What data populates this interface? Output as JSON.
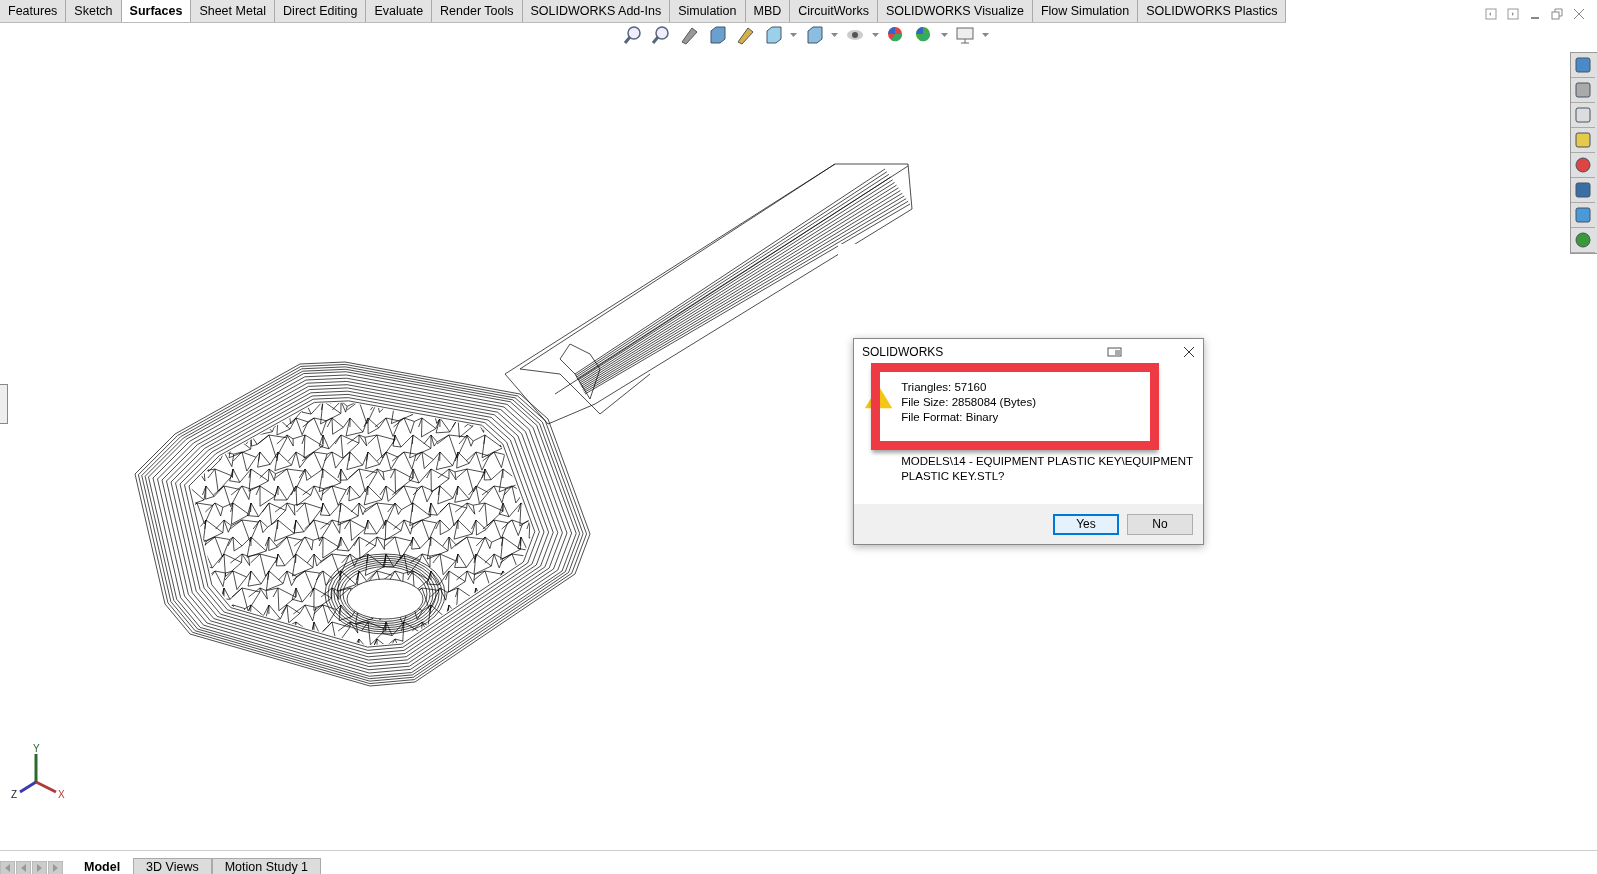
{
  "ribbon_tabs": [
    {
      "label": "Features",
      "selected": false
    },
    {
      "label": "Sketch",
      "selected": false
    },
    {
      "label": "Surfaces",
      "selected": true
    },
    {
      "label": "Sheet Metal",
      "selected": false
    },
    {
      "label": "Direct Editing",
      "selected": false
    },
    {
      "label": "Evaluate",
      "selected": false
    },
    {
      "label": "Render Tools",
      "selected": false
    },
    {
      "label": "SOLIDWORKS Add-Ins",
      "selected": false
    },
    {
      "label": "Simulation",
      "selected": false
    },
    {
      "label": "MBD",
      "selected": false
    },
    {
      "label": "CircuitWorks",
      "selected": false
    },
    {
      "label": "SOLIDWORKS Visualize",
      "selected": false
    },
    {
      "label": "Flow Simulation",
      "selected": false
    },
    {
      "label": "SOLIDWORKS Plastics",
      "selected": false
    }
  ],
  "dialog": {
    "title": "SOLIDWORKS",
    "info_lines": [
      "Triangles: 57160",
      "File Size: 2858084 (Bytes)",
      "File Format: Binary"
    ],
    "question_lines": [
      "MODELS\\14 - EQUIPMENT PLASTIC KEY\\EQUIPMENT",
      "PLASTIC KEY.STL?"
    ],
    "buttons": [
      {
        "label": "Yes",
        "focused": true
      },
      {
        "label": "No",
        "focused": false
      }
    ]
  },
  "triad": {
    "y": "Y",
    "z": "Z",
    "x": "X"
  },
  "bottom_tabs": [
    {
      "label": "Model",
      "selected": true
    },
    {
      "label": "3D Views",
      "selected": false
    },
    {
      "label": "Motion Study 1",
      "selected": false
    }
  ]
}
